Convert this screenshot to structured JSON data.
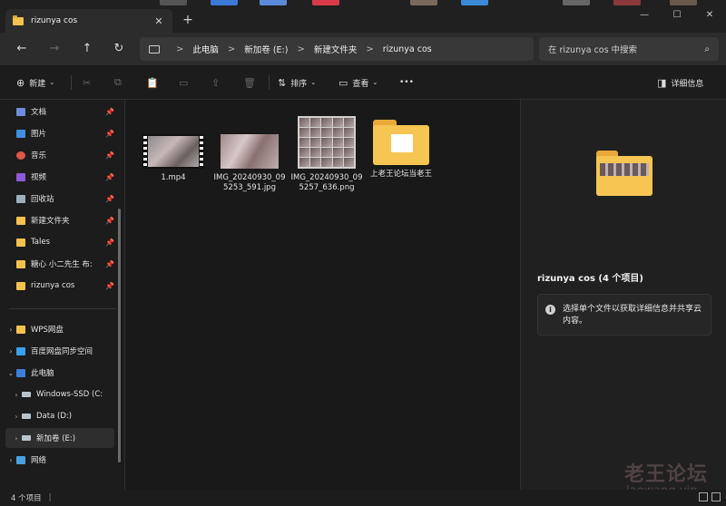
{
  "window": {
    "tab_title": "rizunya cos",
    "tab_close": "✕",
    "new_tab": "+",
    "controls": [
      "—",
      "☐",
      "✕"
    ]
  },
  "nav": {
    "back": "←",
    "forward": "→",
    "up": "↑",
    "refresh": "↻"
  },
  "breadcrumb": [
    "此电脑",
    "新加卷 (E:)",
    "新建文件夹",
    "rizunya cos"
  ],
  "breadcrumb_separator": ">",
  "search": {
    "placeholder": "在 rizunya cos 中搜索",
    "icon": "search-icon"
  },
  "command_bar": {
    "new": "新建",
    "sort": "排序",
    "view": "查看",
    "more": "•••",
    "details": "详细信息"
  },
  "sidebar": {
    "quick_access": [
      {
        "label": "文档",
        "icon": "document-icon",
        "pinned": true
      },
      {
        "label": "图片",
        "icon": "pictures-icon",
        "pinned": true
      },
      {
        "label": "音乐",
        "icon": "music-icon",
        "pinned": true
      },
      {
        "label": "视频",
        "icon": "video-icon",
        "pinned": true
      },
      {
        "label": "回收站",
        "icon": "recycle-bin-icon",
        "pinned": true
      },
      {
        "label": "新建文件夹",
        "icon": "folder-icon",
        "pinned": true
      },
      {
        "label": "Tales",
        "icon": "folder-icon",
        "pinned": true
      },
      {
        "label": "糖心 小二先生 布:",
        "icon": "folder-icon",
        "pinned": true
      },
      {
        "label": "rizunya cos",
        "icon": "folder-icon",
        "pinned": true
      }
    ],
    "tree": [
      {
        "label": "WPS网盘",
        "icon": "wps-cloud-icon",
        "level": 0
      },
      {
        "label": "百度网盘同步空间",
        "icon": "baidu-cloud-icon",
        "level": 0
      },
      {
        "label": "此电脑",
        "icon": "this-pc-icon",
        "level": 0,
        "expanded": true
      },
      {
        "label": "Windows-SSD (C:",
        "icon": "drive-icon",
        "level": 1
      },
      {
        "label": "Data (D:)",
        "icon": "drive-icon",
        "level": 1
      },
      {
        "label": "新加卷 (E:)",
        "icon": "drive-icon",
        "level": 1,
        "selected": true
      },
      {
        "label": "网络",
        "icon": "network-icon",
        "level": 0
      }
    ]
  },
  "files": [
    {
      "name": "1.mp4",
      "type": "video"
    },
    {
      "name": "IMG_20240930_095253_591.jpg",
      "type": "image"
    },
    {
      "name": "IMG_20240930_095257_636.png",
      "type": "image"
    },
    {
      "name": "上老王论坛当老王",
      "type": "folder"
    }
  ],
  "details_pane": {
    "title": "rizunya cos (4 个项目)",
    "info_icon": "i",
    "info_text": "选择单个文件以获取详细信息并共享云内容。"
  },
  "status": {
    "count": "4 个项目",
    "bar": "|"
  },
  "watermark": {
    "line1": "老王论坛",
    "line2": "laowang.vip"
  }
}
